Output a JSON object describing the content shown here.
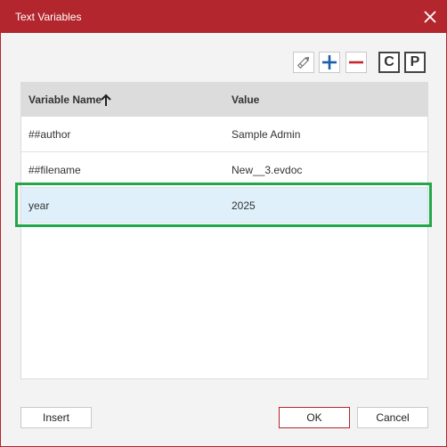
{
  "dialog": {
    "title": "Text Variables",
    "accent_color": "#b3262d"
  },
  "toolbar": {
    "edit_icon": "pencil-icon",
    "add_icon": "plus-icon",
    "remove_icon": "minus-icon",
    "copy_label": "C",
    "paste_label": "P"
  },
  "table": {
    "columns": [
      "Variable Name",
      "Value"
    ],
    "sort": "ascending",
    "rows": [
      {
        "name": "##author",
        "value": "Sample Admin"
      },
      {
        "name": "##filename",
        "value": "New__3.evdoc"
      },
      {
        "name": "year",
        "value": "2025"
      }
    ],
    "selected_row_color": "#dff0fb",
    "highlight_color": "#20a84a"
  },
  "footer": {
    "insert_label": "Insert",
    "ok_label": "OK",
    "cancel_label": "Cancel"
  }
}
